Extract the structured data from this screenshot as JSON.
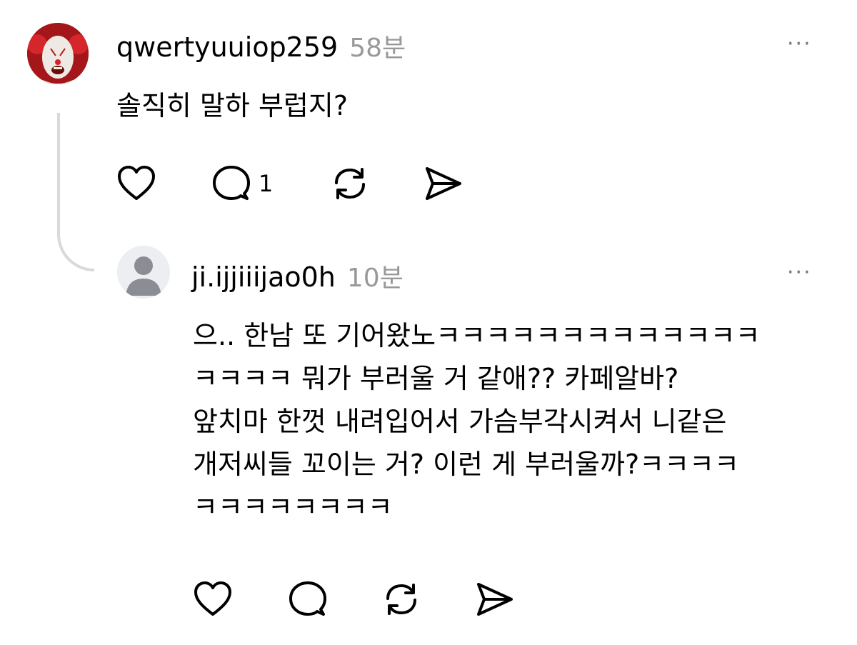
{
  "post": {
    "username": "qwertyuuiop259",
    "time": "58분",
    "more": "···",
    "text": "솔직히 말하 부럽지?",
    "reply_count": "1",
    "icons": [
      "heart-icon",
      "comment-icon",
      "repost-icon",
      "send-icon"
    ]
  },
  "reply": {
    "username": "ji.ijjiiijao0h",
    "time": "10분",
    "more": "···",
    "lines": [
      "으.. 한남 또 기어왔노ㅋㅋㅋㅋㅋㅋㅋㅋㅋㅋㅋㅋㅋ",
      "ㅋㅋㅋㅋ 뭐가 부러울 거 같애?? 카페알바?",
      "앞치마 한껏 내려입어서 가슴부각시켜서 니같은",
      "개저씨들 꼬이는 거? 이런 게 부러울까?ㅋㅋㅋㅋ",
      "ㅋㅋㅋㅋㅋㅋㅋㅋ"
    ],
    "icons": [
      "heart-icon",
      "comment-icon",
      "repost-icon",
      "send-icon"
    ]
  },
  "colors": {
    "text": "#000000",
    "muted": "#999999",
    "thread_line": "#d9d9d9",
    "avatar_default": "#c8c9cc"
  }
}
